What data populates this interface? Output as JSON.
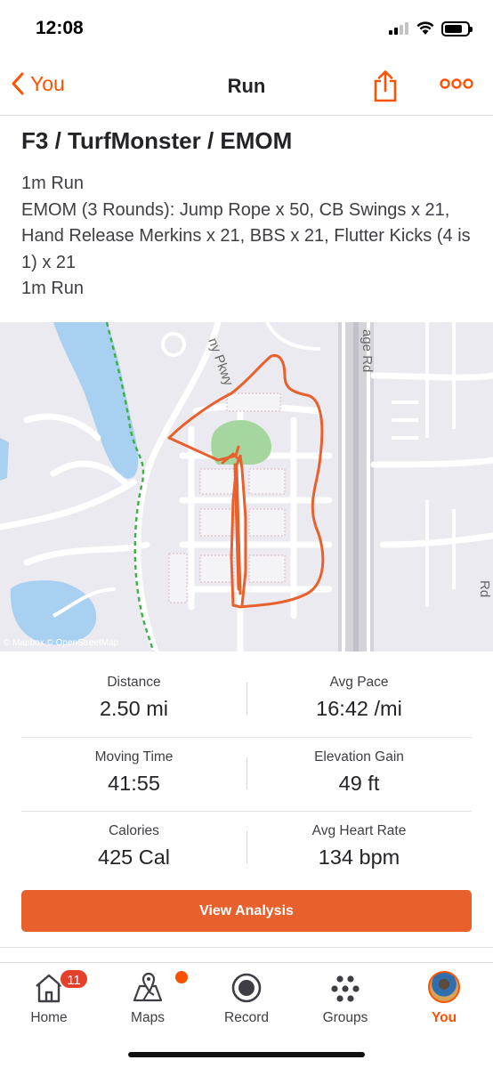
{
  "status_bar": {
    "time": "12:08"
  },
  "nav": {
    "back_label": "You",
    "title": "Run"
  },
  "activity": {
    "title": "F3 / TurfMonster / EMOM",
    "description_lines": [
      "1m Run",
      "EMOM (3 Rounds): Jump Rope x 50, CB Swings x 21, Hand Release Merkins x 21, BBS x 21, Flutter Kicks (4 is 1) x 21",
      "1m Run"
    ]
  },
  "map": {
    "credit": "© Mapbox © OpenStreetMap",
    "street_labels": [
      "ny Pkwy",
      "age Rd",
      "Rd"
    ],
    "route_color": "#e8602c",
    "trail_color": "#3cb043",
    "water_color": "#a8d0f0",
    "park_color": "#a6d6a0"
  },
  "stats": {
    "rows": [
      {
        "left": {
          "label": "Distance",
          "value": "2.50 mi"
        },
        "right": {
          "label": "Avg Pace",
          "value": "16:42 /mi"
        }
      },
      {
        "left": {
          "label": "Moving Time",
          "value": "41:55"
        },
        "right": {
          "label": "Elevation Gain",
          "value": "49 ft"
        }
      },
      {
        "left": {
          "label": "Calories",
          "value": "425 Cal"
        },
        "right": {
          "label": "Avg Heart Rate",
          "value": "134 bpm"
        }
      }
    ]
  },
  "view_analysis_label": "View Analysis",
  "tabs": [
    {
      "label": "Home",
      "icon": "home-icon",
      "badge": "11"
    },
    {
      "label": "Maps",
      "icon": "maps-icon"
    },
    {
      "label": "Record",
      "icon": "record-icon"
    },
    {
      "label": "Groups",
      "icon": "groups-icon"
    },
    {
      "label": "You",
      "icon": "avatar",
      "active": true
    }
  ],
  "colors": {
    "accent": "#fc5200",
    "button": "#e8602c",
    "badge": "#e4402c"
  }
}
